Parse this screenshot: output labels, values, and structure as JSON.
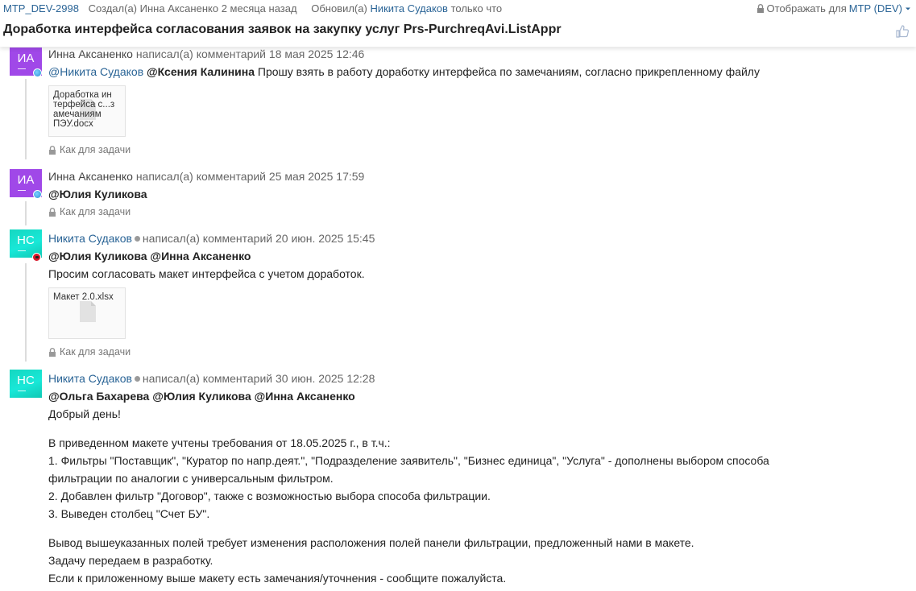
{
  "header": {
    "task_id": "MTP_DEV-2998",
    "created_label": "Создал(а)",
    "created_by": "Инна Аксаненко",
    "created_when": "2 месяца назад",
    "updated_label": "Обновил(а)",
    "updated_by": "Никита Судаков",
    "updated_when": "только что",
    "visibility_label": "Отображать для",
    "visibility_value": "MTP (DEV)",
    "title": "Доработка интерфейса согласования заявок на закупку услуг Prs-PurchreqAvi.ListAppr"
  },
  "comments": [
    {
      "initials": "ИА",
      "author": "Инна Аксаненко",
      "action": "написал(а) комментарий",
      "date": "18 мая 2025 12:46",
      "mention_link": "@Никита Судаков",
      "mention_bold": "@Ксения Калинина",
      "text": "Прошу взять в работу доработку интерфейса по замечаниям, согласно прикрепленному файлу",
      "attachment": "Доработка ин\nтерфейса с...з\nамечаниям\nПЭУ.docx",
      "visibility": "Как для задачи"
    },
    {
      "initials": "ИА",
      "author": "Инна Аксаненко",
      "action": "написал(а) комментарий",
      "date": "25 мая 2025 17:59",
      "mentions": "@Юлия Куликова",
      "visibility": "Как для задачи"
    },
    {
      "initials": "НС",
      "author": "Никита Судаков",
      "action": "написал(а) комментарий",
      "date": "20 июн. 2025 15:45",
      "mentions": "@Юлия Куликова @Инна Аксаненко",
      "text": "Просим согласовать макет интерфейса с учетом доработок.",
      "attachment": "Макет 2.0.xlsx",
      "visibility": "Как для задачи"
    },
    {
      "initials": "НС",
      "author": "Никита Судаков",
      "action": "написал(а) комментарий",
      "date": "30 июн. 2025 12:28",
      "mentions": "@Ольга Бахарева @Юлия Куликова @Инна Аксаненко",
      "lines": [
        "Добрый день!",
        "В приведенном макете учтены требования от 18.05.2025 г., в т.ч.:",
        "1. Фильтры \"Поставщик\", \"Куратор по напр.деят.\", \"Подразделение заявитель\", \"Бизнес единица\", \"Услуга\" - дополнены выбором способа",
        "фильтрации по аналогии с универсальным фильтром.",
        "2. Добавлен фильтр \"Договор\", также с возможностью выбора способа фильтрации.",
        "3. Выведен столбец \"Счет БУ\".",
        "Вывод вышеуказанных полей требует изменения расположения полей панели фильтрации, предложенный нами в макете.",
        "Задачу передаем в разработку.",
        "Если к приложенному выше макету есть замечания/уточнения - сообщите пожалуйста."
      ]
    }
  ],
  "colors": {
    "link": "#2a6496",
    "avatar_purple": "#a048e8",
    "avatar_teal": "#16d7c0"
  },
  "icons": [
    "lock-icon",
    "caret-down-icon",
    "thumbs-up-icon",
    "file-icon",
    "status-dot-icon"
  ]
}
